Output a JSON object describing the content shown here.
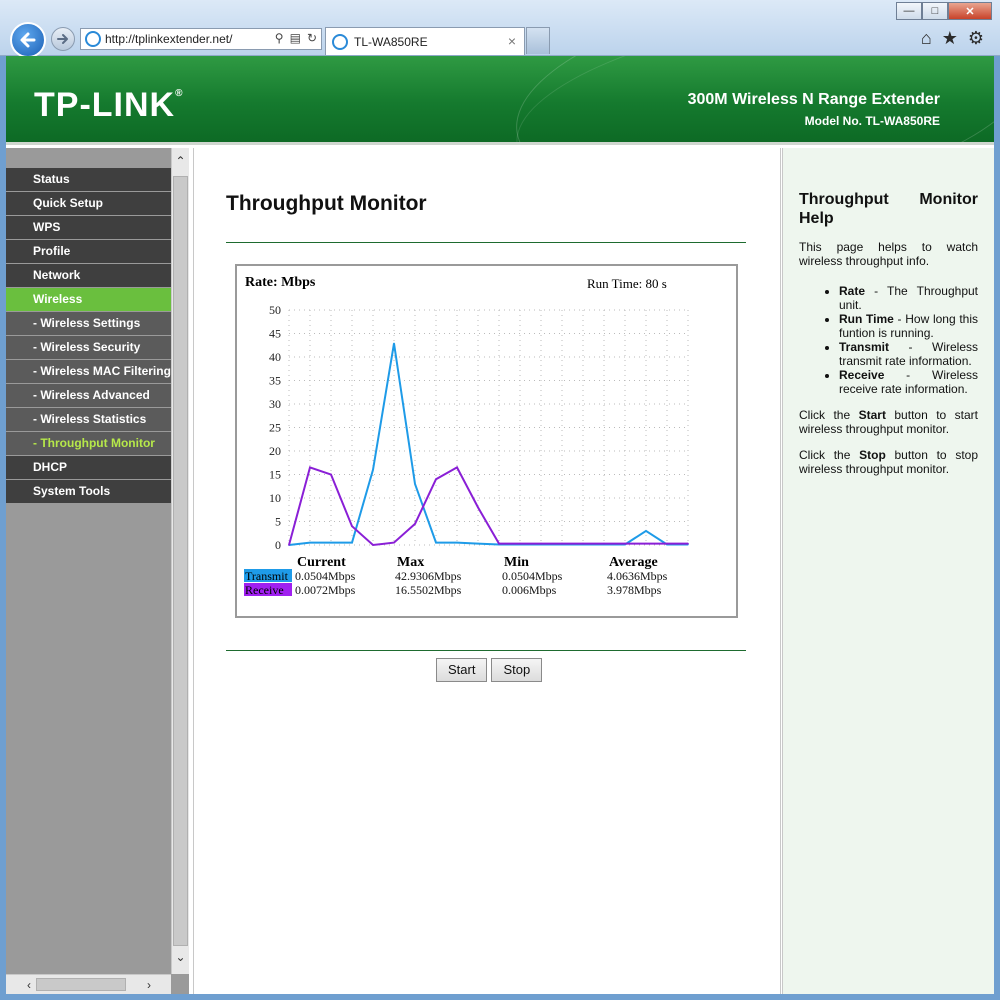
{
  "browser": {
    "url": "http://tplinkextender.net/",
    "tab_title": "TL-WA850RE",
    "tab_close": "×",
    "window_buttons": [
      "minimize-icon",
      "maximize-icon",
      "close-icon"
    ],
    "tool_icons": [
      "home-icon",
      "favorites-icon",
      "settings-gear-icon"
    ]
  },
  "banner": {
    "logo": "TP-LINK",
    "logo_mark": "®",
    "product": "300M Wireless N Range Extender",
    "model": "Model No. TL-WA850RE"
  },
  "menu": [
    {
      "label": "Status",
      "state": "normal"
    },
    {
      "label": "Quick Setup",
      "state": "normal"
    },
    {
      "label": "WPS",
      "state": "normal"
    },
    {
      "label": "Profile",
      "state": "normal"
    },
    {
      "label": "Network",
      "state": "normal"
    },
    {
      "label": "Wireless",
      "state": "active"
    },
    {
      "label": "- Wireless Settings",
      "state": "sub"
    },
    {
      "label": "- Wireless Security",
      "state": "sub"
    },
    {
      "label": "- Wireless MAC Filtering",
      "state": "sub"
    },
    {
      "label": "- Wireless Advanced",
      "state": "sub"
    },
    {
      "label": "- Wireless Statistics",
      "state": "sub"
    },
    {
      "label": "- Throughput Monitor",
      "state": "sub-current"
    },
    {
      "label": "DHCP",
      "state": "normal"
    },
    {
      "label": "System Tools",
      "state": "normal"
    }
  ],
  "main": {
    "title": "Throughput Monitor",
    "start_label": "Start",
    "stop_label": "Stop"
  },
  "chart_data": {
    "type": "line",
    "title": "Rate: Mbps",
    "run_time": "Run Time: 80 s",
    "ylim": [
      0,
      50
    ],
    "y_ticks": [
      0,
      5,
      10,
      15,
      20,
      25,
      30,
      35,
      40,
      45,
      50
    ],
    "grid": true,
    "series": [
      {
        "name": "Transmit",
        "color": "#1e9be8",
        "values": [
          0,
          0.5,
          0.5,
          0.5,
          16,
          42.9,
          13,
          0.5,
          0.5,
          0.3,
          0.1,
          0.1,
          0.1,
          0.1,
          0.1,
          0.1,
          0.1,
          3,
          0.1,
          0.1
        ]
      },
      {
        "name": "Receive",
        "color": "#8a1fd6",
        "values": [
          0,
          16.5,
          15,
          4,
          0,
          0.5,
          4.5,
          14,
          16.5,
          8,
          0.3,
          0.3,
          0.3,
          0.3,
          0.3,
          0.3,
          0.3,
          0.3,
          0.3,
          0.3
        ]
      }
    ],
    "stats_headers": [
      "Current",
      "Max",
      "Min",
      "Average"
    ],
    "stats": [
      {
        "name": "Transmit",
        "color": "#1e9be8",
        "values": [
          "0.0504Mbps",
          "42.9306Mbps",
          "0.0504Mbps",
          "4.0636Mbps"
        ]
      },
      {
        "name": "Receive",
        "color": "#a020f0",
        "values": [
          "0.0072Mbps",
          "16.5502Mbps",
          "0.006Mbps",
          "3.978Mbps"
        ]
      }
    ]
  },
  "help": {
    "title_line1": "Throughput Monitor",
    "title_line2": "Help",
    "intro": "This page helps to watch wireless throughput info.",
    "items": [
      {
        "term": "Rate",
        "desc": " - The Throughput unit."
      },
      {
        "term": "Run Time",
        "desc": " - How long this funtion is running."
      },
      {
        "term": "Transmit",
        "desc": " - Wireless transmit rate information."
      },
      {
        "term": "Receive",
        "desc": " - Wireless receive rate information."
      }
    ],
    "start_note": {
      "pre": "Click the ",
      "term": "Start",
      "post": " button to start wireless throughput monitor."
    },
    "stop_note": {
      "pre": "Click the ",
      "term": "Stop",
      "post": " button to stop wireless throughput monitor."
    }
  }
}
